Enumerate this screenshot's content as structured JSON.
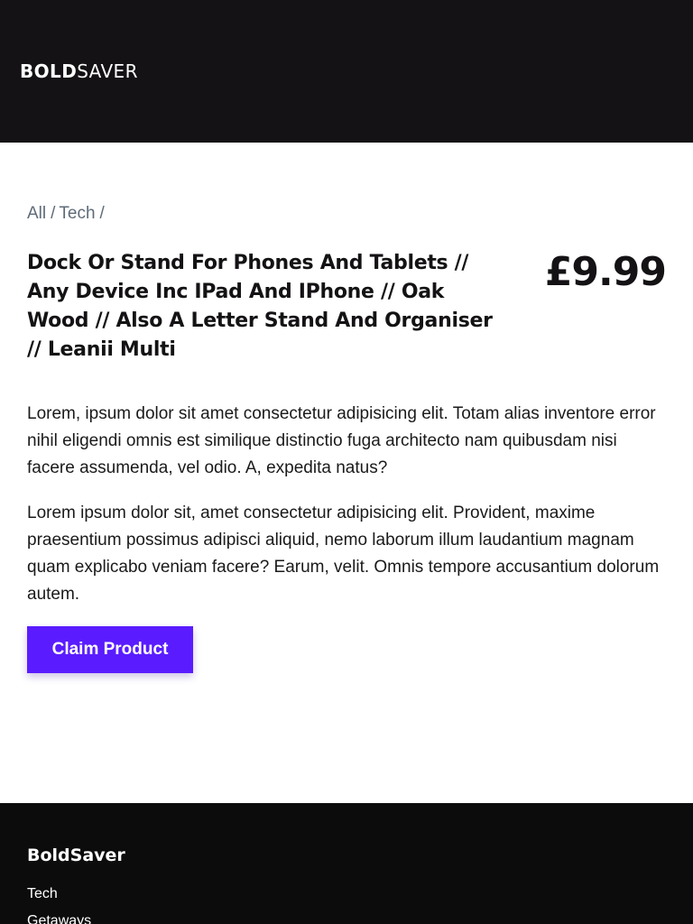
{
  "header": {
    "logo_bold": "BOLD",
    "logo_light": "SAVER"
  },
  "breadcrumb": {
    "items": [
      "All",
      "Tech"
    ],
    "separator": "/"
  },
  "product": {
    "title": "Dock Or Stand For Phones And Tablets // Any Device Inc IPad And IPhone // Oak Wood // Also A Letter Stand And Organiser // Leanii Multi",
    "price": "£9.99",
    "description": [
      "Lorem, ipsum dolor sit amet consectetur adipisicing elit. Totam alias inventore error nihil eligendi omnis est similique distinctio fuga architecto nam quibusdam nisi facere assumenda, vel odio. A, expedita natus?",
      "Lorem ipsum dolor sit, amet consectetur adipisicing elit. Provident, maxime praesentium possimus adipisci aliquid, nemo laborum illum laudantium magnam quam explicabo veniam facere? Earum, velit. Omnis tempore accusantium dolorum autem."
    ],
    "claim_label": "Claim Product"
  },
  "footer": {
    "brand": "BoldSaver",
    "links": [
      "Tech",
      "Getaways"
    ]
  },
  "colors": {
    "header_bg": "#141214",
    "footer_bg": "#0d0c0d",
    "accent": "#5a1cff",
    "breadcrumb": "#5f6b78"
  }
}
